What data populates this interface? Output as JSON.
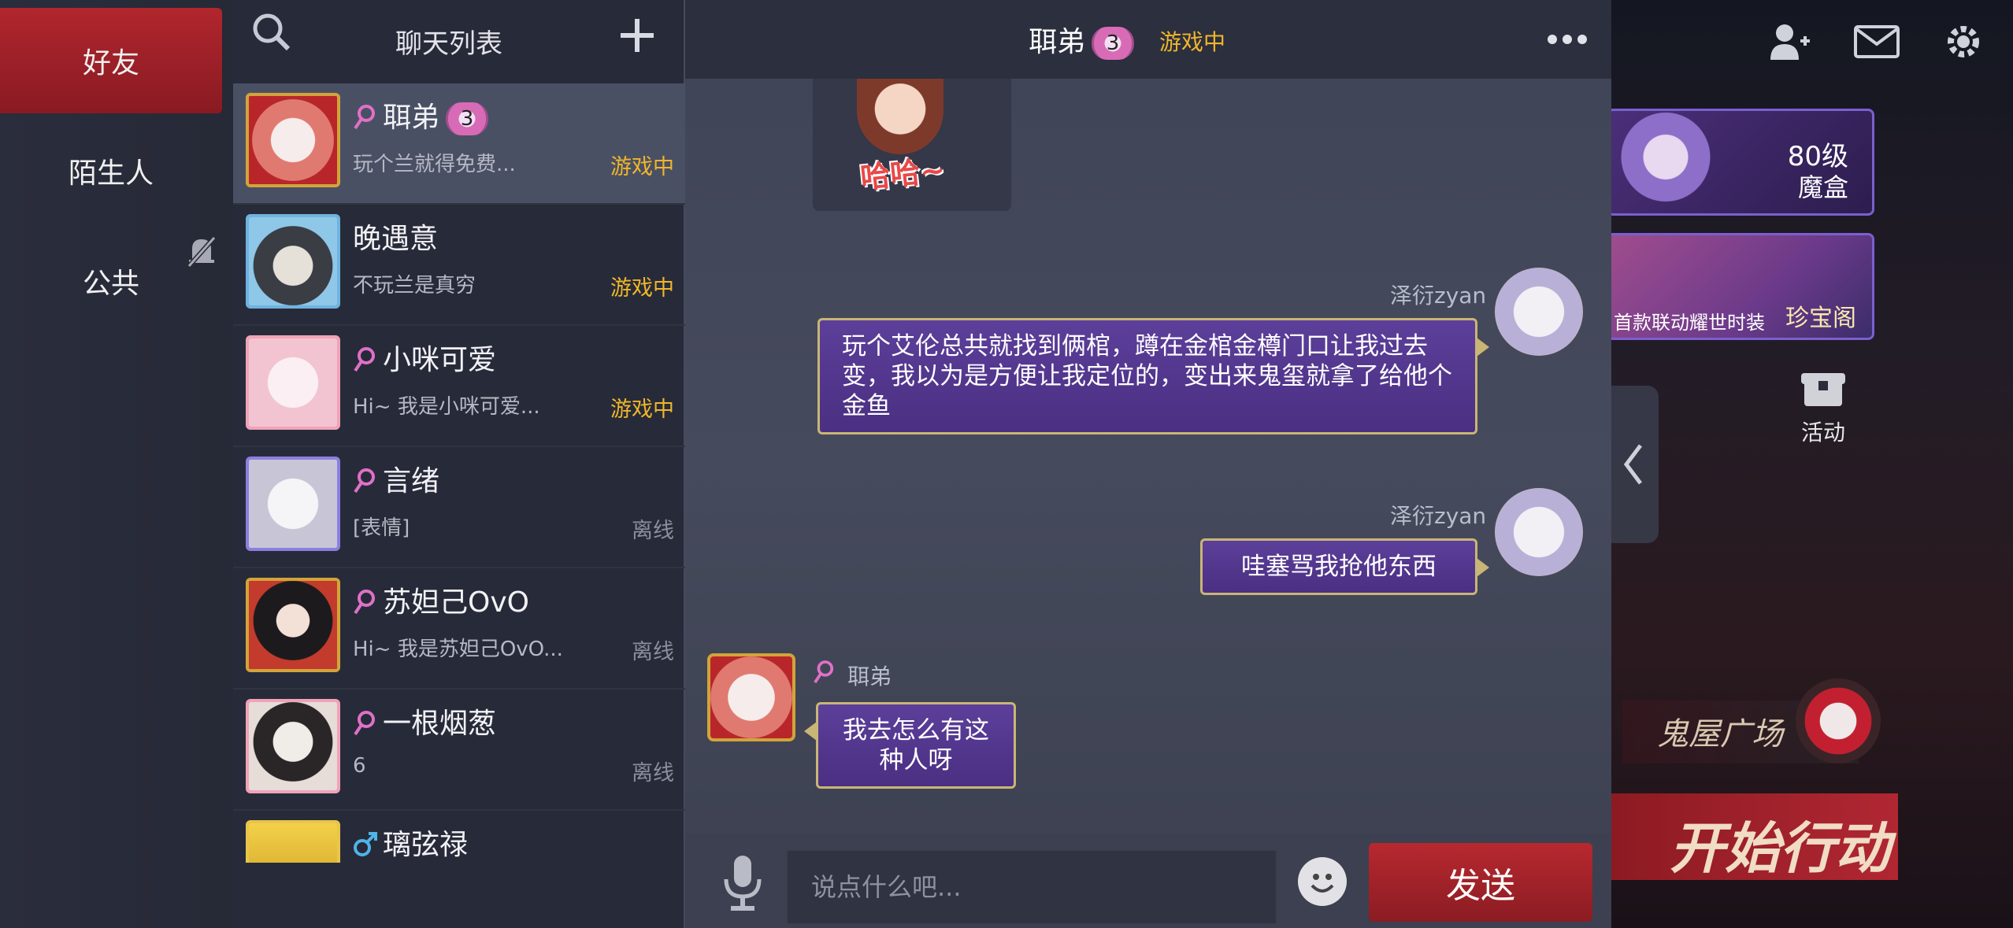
{
  "tabs": {
    "friends": "好友",
    "strangers": "陌生人",
    "public": "公共"
  },
  "list": {
    "title": "聊天列表",
    "items": [
      {
        "name": "聑弟",
        "badge": "3",
        "preview": "玩个兰就得免费...",
        "status": "游戏中",
        "gender": "female"
      },
      {
        "name": "晚遇意",
        "preview": "不玩兰是真穷",
        "status": "游戏中",
        "gender": "none"
      },
      {
        "name": "小咪可爱",
        "preview": "Hi~ 我是小咪可爱...",
        "status": "游戏中",
        "gender": "female"
      },
      {
        "name": "言绪",
        "preview": "[表情]",
        "status": "离线",
        "gender": "female"
      },
      {
        "name": "苏妲己OvO",
        "preview": "Hi~ 我是苏妲己OvO...",
        "status": "离线",
        "gender": "female"
      },
      {
        "name": "一根烟葱",
        "preview": "6",
        "status": "离线",
        "gender": "female"
      },
      {
        "name": "璃弦禄",
        "preview": "",
        "status": "",
        "gender": "male"
      }
    ]
  },
  "chat": {
    "peer_name": "聑弟",
    "peer_badge": "3",
    "peer_status": "游戏中",
    "sticker_text": "哈哈~",
    "messages": [
      {
        "sender": "泽衍zyan",
        "side": "right",
        "text": "玩个艾伦总共就找到俩棺，蹲在金棺金樽门口让我过去变，我以为是方便让我定位的，变出来鬼玺就拿了给他个金鱼"
      },
      {
        "sender": "泽衍zyan",
        "side": "right",
        "text": "哇塞骂我抢他东西"
      },
      {
        "sender": "聑弟",
        "side": "left",
        "text": "我去怎么有这种人呀"
      }
    ],
    "input_placeholder": "说点什么吧...",
    "send_label": "发送"
  },
  "scene": {
    "level": "80级",
    "magic_box": "魔盒",
    "pavilion_caption": "首款联动耀世时装",
    "pavilion": "珍宝阁",
    "activity": "活动",
    "haunted_plaza": "鬼屋广场",
    "start_action": "开始行动"
  },
  "colors": {
    "accent_red": "#b1262d",
    "playing": "#f0b62a",
    "offline": "#8c8f9b",
    "bubble": "#5c3f9a",
    "bubble_border": "#c9b576"
  }
}
